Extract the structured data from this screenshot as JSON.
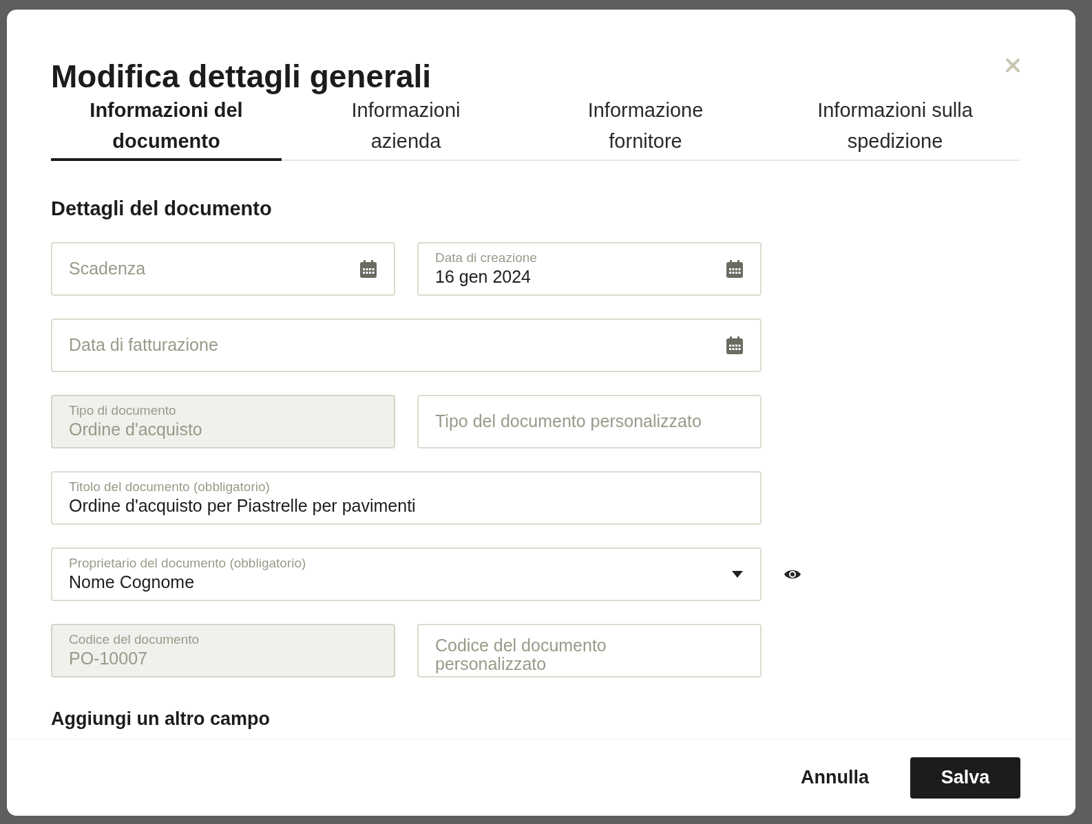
{
  "dialog": {
    "title": "Modifica dettagli generali",
    "tabs": [
      {
        "label": "Informazioni del documento",
        "selected": true
      },
      {
        "label": "Informazioni azienda",
        "selected": false
      },
      {
        "label": "Informazione fornitore",
        "selected": false
      },
      {
        "label": "Informazioni sulla spedizione",
        "selected": false
      }
    ],
    "section_title": "Dettagli del documento",
    "rows": [
      {
        "kind": "plain",
        "fields": [
          {
            "kind": "date",
            "placeholder": "Scadenza",
            "disabled": false
          },
          {
            "kind": "date",
            "label": "Data di creazione",
            "value": "16 gen 2024",
            "disabled": false
          }
        ]
      },
      {
        "kind": "plain",
        "fields": [
          {
            "kind": "date",
            "placeholder": "Data di fatturazione",
            "disabled": false
          }
        ]
      },
      {
        "kind": "plain",
        "fields": [
          {
            "kind": "text",
            "label": "Tipo di documento",
            "value": "Ordine d'acquisto",
            "disabled": true
          },
          {
            "kind": "text",
            "placeholder": "Tipo del documento personalizzato",
            "disabled": false
          }
        ]
      },
      {
        "kind": "plain",
        "fields": [
          {
            "kind": "text",
            "label": "Titolo del documento (obbligatorio)",
            "value": "Ordine d'acquisto per Piastrelle per pavimenti",
            "disabled": false
          }
        ]
      },
      {
        "kind": "visibility",
        "fields": [
          {
            "kind": "select",
            "label": "Proprietario del documento (obbligatorio)",
            "value": "Nome Cognome",
            "disabled": false
          }
        ]
      },
      {
        "kind": "plain",
        "fields": [
          {
            "kind": "text",
            "label": "Codice del documento",
            "value": "PO-10007",
            "disabled": true
          },
          {
            "kind": "multiline",
            "placeholder": "Codice del documento personalizzato",
            "disabled": false
          }
        ]
      }
    ],
    "add_field_link": "Aggiungi un altro campo",
    "buttons": [
      {
        "kind": "secondary",
        "label": "Annulla"
      },
      {
        "kind": "primary",
        "label": "Salva"
      }
    ]
  }
}
